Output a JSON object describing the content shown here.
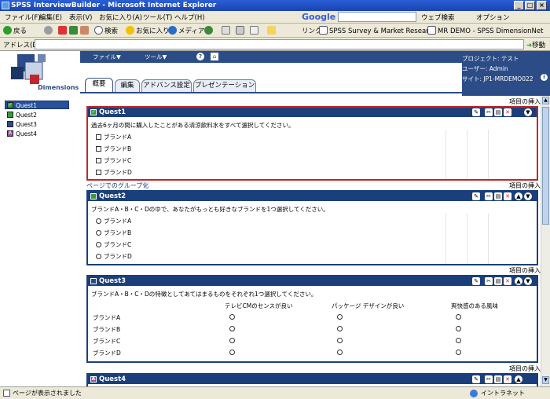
{
  "window": {
    "title": "SPSS InterviewBuilder - Microsoft Internet Explorer"
  },
  "menubar": {
    "items": [
      "ファイル(F)",
      "編集(E)",
      "表示(V)",
      "お気に入り(A)",
      "ツール(T)",
      "ヘルプ(H)"
    ]
  },
  "toolbar": {
    "back": "戻る",
    "search": "検索",
    "favorites": "お気に入り",
    "media": "メディア",
    "google": "Google",
    "web_search": "ウェブ検索",
    "options": "オプション"
  },
  "addressbar": {
    "label": "アドレス(D)",
    "value": "",
    "go": "移動",
    "links_label": "リンク",
    "links": [
      "SPSS Survey & Market Research",
      "MR DEMO - SPSS DimensionNet"
    ]
  },
  "app": {
    "logo": "Dimensions",
    "header_menu": {
      "file": "ファイル▼",
      "tool": "ツール▼"
    },
    "project": "プロジェクト: テスト",
    "user": "ユーザー: Admin",
    "site": "サイト: JP1-MRDEMO022",
    "tabs": [
      "概要",
      "編集",
      "アドバンス設定",
      "プレゼンテーション"
    ],
    "active_tab": "概要",
    "colors": {
      "header": "#2b4c87",
      "selected_border": "#c0272d"
    }
  },
  "sidebar": {
    "items": [
      {
        "label": "Quest1",
        "icon": "checkbox-icon"
      },
      {
        "label": "Quest2",
        "icon": "radio-icon"
      },
      {
        "label": "Quest3",
        "icon": "grid-icon"
      },
      {
        "label": "Quest4",
        "icon": "text-icon"
      }
    ]
  },
  "main": {
    "insert_label": "項目の挿入",
    "group_label": "ページでのグループ化",
    "questions": [
      {
        "name": "Quest1",
        "text": "過去6ヶ月の間に購入したことがある清涼飲料水をすべて選択してください。",
        "options": [
          "ブランドA",
          "ブランドB",
          "ブランドC",
          "ブランドD"
        ]
      },
      {
        "name": "Quest2",
        "text": "ブランドA・B・C・Dの中で、あなたがもっとも好きなブランドを1つ選択してください。",
        "options": [
          "ブランドA",
          "ブランドB",
          "ブランドC",
          "ブランドD"
        ]
      },
      {
        "name": "Quest3",
        "text": "ブランドA・B・C・Dの特徴としてあてはまるものをそれぞれ1つ選択してください。",
        "columns": [
          "テレビCMのセンスが良い",
          "パッケージ デザインが良い",
          "爽快感のある風味"
        ],
        "rows": [
          "ブランドA",
          "ブランドB",
          "ブランドC",
          "ブランドD"
        ]
      },
      {
        "name": "Quest4",
        "text": ""
      }
    ]
  },
  "statusbar": {
    "text": "ページが表示されました",
    "zone": "イントラネット"
  }
}
